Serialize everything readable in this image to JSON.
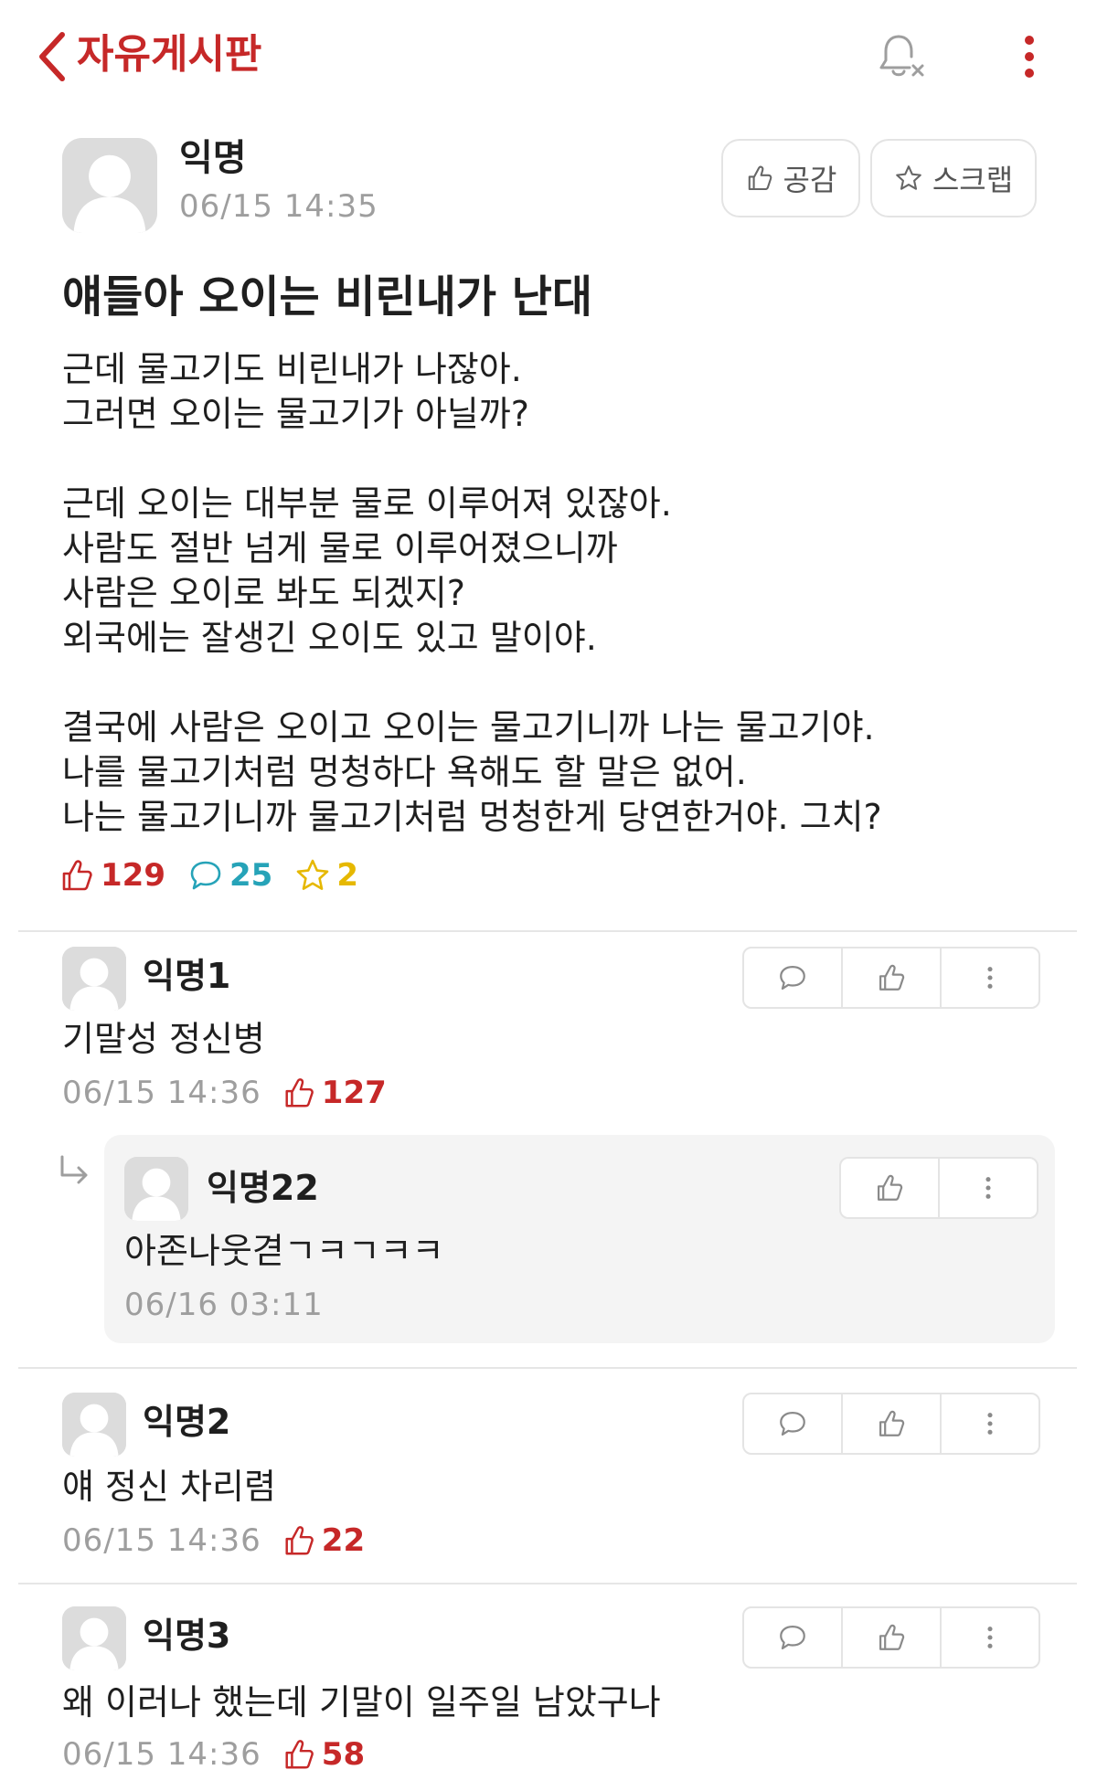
{
  "header": {
    "title": "자유게시판",
    "back_icon": "chevron-left-icon",
    "notification_icon": "bell-off-icon",
    "more_icon": "kebab-icon",
    "accent_color": "#c62828"
  },
  "post": {
    "author": "익명",
    "time": "06/15 14:35",
    "like_button_label": "공감",
    "scrap_button_label": "스크랩",
    "title": "얘들아 오이는 비린내가 난대",
    "body_lines": [
      "근데 물고기도 비린내가 나잖아.",
      "그러면 오이는 물고기가 아닐까?",
      "",
      "근데 오이는 대부분 물로 이루어져 있잖아.",
      "사람도 절반 넘게 물로 이루어졌으니까",
      "사람은 오이로 봐도 되겠지?",
      "외국에는 잘생긴 오이도 있고 말이야.",
      "",
      "결국에 사람은 오이고 오이는 물고기니까 나는 물고기야.",
      "나를 물고기처럼 멍청하다 욕해도 할 말은 없어.",
      "나는 물고기니까 물고기처럼 멍청한게 당연한거야. 그치?"
    ],
    "stats": {
      "likes": "129",
      "comments": "25",
      "scraps": "2",
      "like_color": "#c62828",
      "comment_color": "#26a3b8",
      "scrap_color": "#e6b800"
    }
  },
  "comments": [
    {
      "author": "익명1",
      "text": "기말성 정신병",
      "time": "06/15 14:36",
      "likes": "127",
      "reply": {
        "author": "익명22",
        "text": "아존나웃겯ㄱㅋㄱㅋㅋ",
        "time": "06/16 03:11"
      }
    },
    {
      "author": "익명2",
      "text": "얘 정신 차리렴",
      "time": "06/15 14:36",
      "likes": "22"
    },
    {
      "author": "익명3",
      "text": "왜 이러나 했는데 기말이 일주일 남았구나",
      "time": "06/15 14:36",
      "likes": "58"
    }
  ]
}
